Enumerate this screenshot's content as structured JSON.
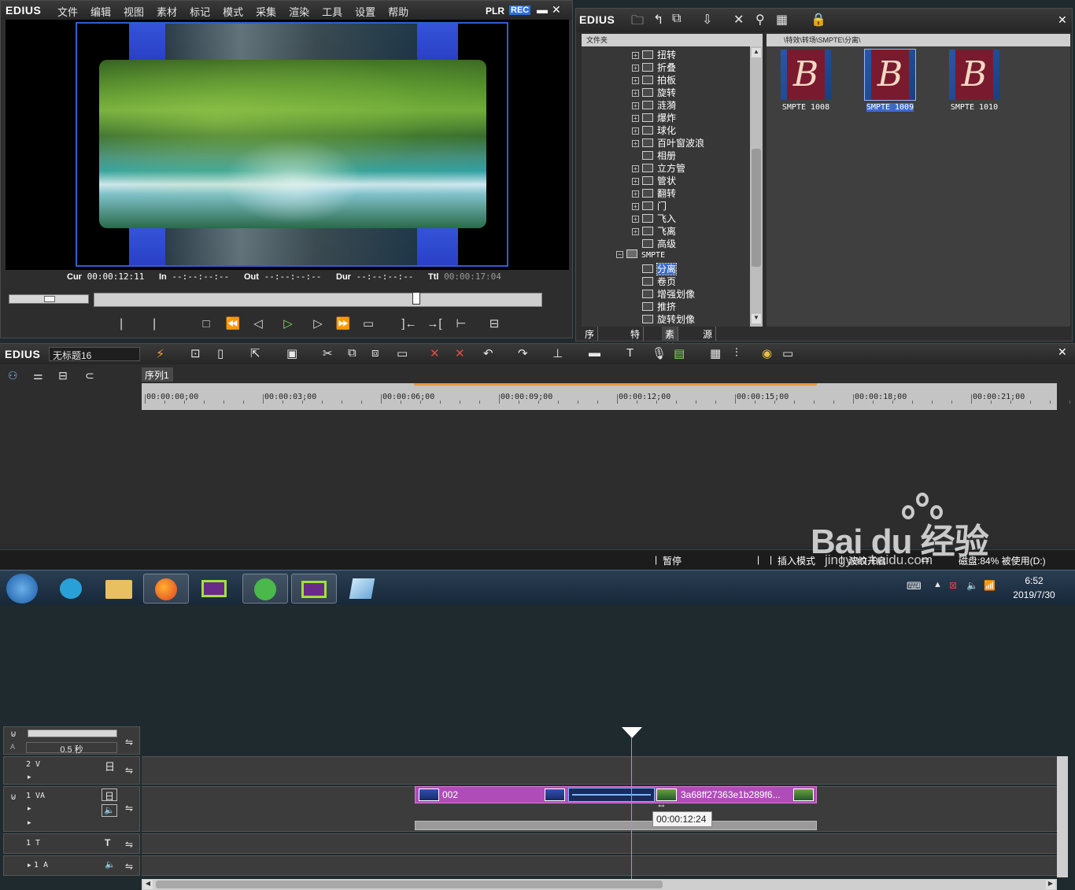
{
  "player": {
    "logo": "EDIUS",
    "menu": [
      "文件",
      "编辑",
      "视图",
      "素材",
      "标记",
      "模式",
      "采集",
      "渲染",
      "工具",
      "设置",
      "帮助"
    ],
    "plr": "PLR",
    "rec": "REC",
    "timecodes": {
      "cur_label": "Cur",
      "cur": "00:00:12:11",
      "in_label": "In",
      "in": "--:--:--:--",
      "out_label": "Out",
      "out": "--:--:--:--",
      "dur_label": "Dur",
      "dur": "--:--:--:--",
      "ttl_label": "Ttl",
      "ttl": "00:00:17:04"
    }
  },
  "bin": {
    "logo": "EDIUS",
    "folder_header": "文件夹",
    "path": "\\特效\\转场\\SMPTE\\分离\\",
    "tree": [
      {
        "label": "扭转",
        "expand": true
      },
      {
        "label": "折叠",
        "expand": true
      },
      {
        "label": "拍板",
        "expand": true
      },
      {
        "label": "旋转",
        "expand": true
      },
      {
        "label": "涟漪",
        "expand": true
      },
      {
        "label": "爆炸",
        "expand": true
      },
      {
        "label": "球化",
        "expand": true
      },
      {
        "label": "百叶窗波浪",
        "expand": true
      },
      {
        "label": "相册",
        "expand": false
      },
      {
        "label": "立方管",
        "expand": true
      },
      {
        "label": "管状",
        "expand": true
      },
      {
        "label": "翻转",
        "expand": true
      },
      {
        "label": "门",
        "expand": true
      },
      {
        "label": "飞入",
        "expand": true
      },
      {
        "label": "飞离",
        "expand": true
      },
      {
        "label": "高级",
        "expand": false
      }
    ],
    "smpte_folder": "SMPTE",
    "smpte_children": [
      "分离",
      "卷页",
      "增强划像",
      "推挤",
      "旋转划像"
    ],
    "clips": [
      {
        "label": "SMPTE 1008",
        "selected": false
      },
      {
        "label": "SMPTE 1009",
        "selected": true
      },
      {
        "label": "SMPTE 1010",
        "selected": false
      }
    ],
    "tabs": [
      "序列标记",
      "特效",
      "素材库",
      "源文件浏览"
    ]
  },
  "timeline": {
    "logo": "EDIUS",
    "project": "无标题16",
    "sequence_tab": "序列1",
    "zoom": "0.5 秒",
    "ruler": [
      "00:00:00;00",
      "00:00:03;00",
      "00:00:06;00",
      "00:00:09;00",
      "00:00:12;00",
      "00:00:15;00",
      "00:00:18;00",
      "00:00:21;00"
    ],
    "tracks": {
      "v2": "2 V",
      "va1": "1 VA",
      "t1": "1 T",
      "a1": "1 A"
    },
    "clip1_name": "002",
    "clip2_name": "3a68ff27363e1b289f6...",
    "tooltip": "00:00:12:24"
  },
  "status": {
    "pause": "暂停",
    "insert_mode": "插入模式",
    "ripple": "波纹开启",
    "disk": "磁盘:84% 被使用(D:)"
  },
  "taskbar": {
    "time": "6:52",
    "date": "2019/7/30"
  },
  "watermark": {
    "brand": "Bai du 经验",
    "url": "jingyan.baidu.com"
  }
}
